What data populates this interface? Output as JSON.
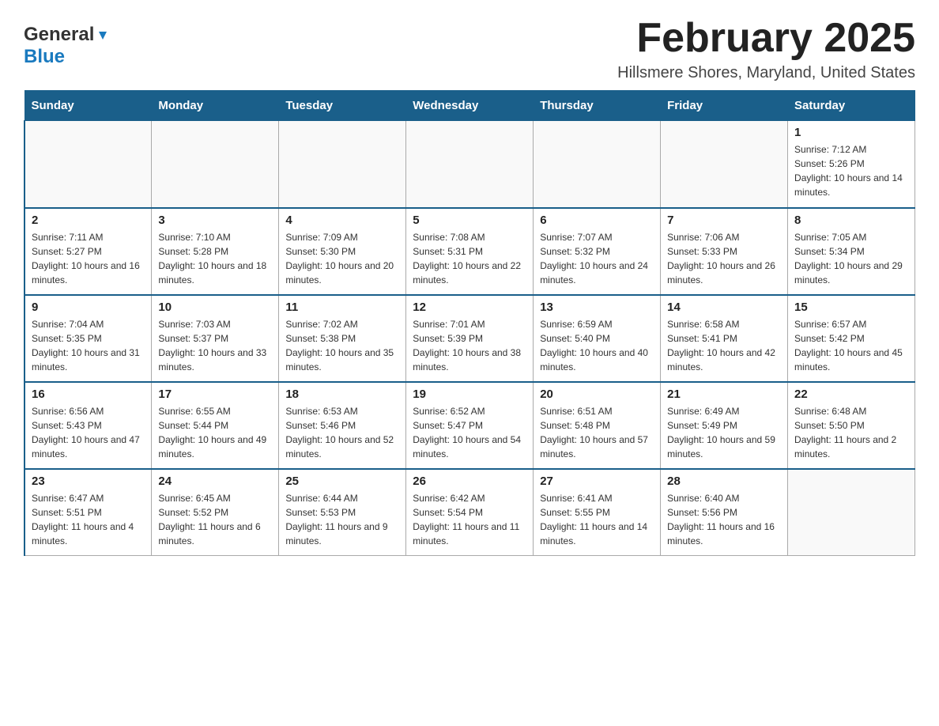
{
  "header": {
    "logo_line1": "General",
    "logo_arrow": "▶",
    "logo_line2": "Blue",
    "month_title": "February 2025",
    "location": "Hillsmere Shores, Maryland, United States"
  },
  "weekdays": [
    "Sunday",
    "Monday",
    "Tuesday",
    "Wednesday",
    "Thursday",
    "Friday",
    "Saturday"
  ],
  "weeks": [
    [
      {
        "day": "",
        "sunrise": "",
        "sunset": "",
        "daylight": ""
      },
      {
        "day": "",
        "sunrise": "",
        "sunset": "",
        "daylight": ""
      },
      {
        "day": "",
        "sunrise": "",
        "sunset": "",
        "daylight": ""
      },
      {
        "day": "",
        "sunrise": "",
        "sunset": "",
        "daylight": ""
      },
      {
        "day": "",
        "sunrise": "",
        "sunset": "",
        "daylight": ""
      },
      {
        "day": "",
        "sunrise": "",
        "sunset": "",
        "daylight": ""
      },
      {
        "day": "1",
        "sunrise": "Sunrise: 7:12 AM",
        "sunset": "Sunset: 5:26 PM",
        "daylight": "Daylight: 10 hours and 14 minutes."
      }
    ],
    [
      {
        "day": "2",
        "sunrise": "Sunrise: 7:11 AM",
        "sunset": "Sunset: 5:27 PM",
        "daylight": "Daylight: 10 hours and 16 minutes."
      },
      {
        "day": "3",
        "sunrise": "Sunrise: 7:10 AM",
        "sunset": "Sunset: 5:28 PM",
        "daylight": "Daylight: 10 hours and 18 minutes."
      },
      {
        "day": "4",
        "sunrise": "Sunrise: 7:09 AM",
        "sunset": "Sunset: 5:30 PM",
        "daylight": "Daylight: 10 hours and 20 minutes."
      },
      {
        "day": "5",
        "sunrise": "Sunrise: 7:08 AM",
        "sunset": "Sunset: 5:31 PM",
        "daylight": "Daylight: 10 hours and 22 minutes."
      },
      {
        "day": "6",
        "sunrise": "Sunrise: 7:07 AM",
        "sunset": "Sunset: 5:32 PM",
        "daylight": "Daylight: 10 hours and 24 minutes."
      },
      {
        "day": "7",
        "sunrise": "Sunrise: 7:06 AM",
        "sunset": "Sunset: 5:33 PM",
        "daylight": "Daylight: 10 hours and 26 minutes."
      },
      {
        "day": "8",
        "sunrise": "Sunrise: 7:05 AM",
        "sunset": "Sunset: 5:34 PM",
        "daylight": "Daylight: 10 hours and 29 minutes."
      }
    ],
    [
      {
        "day": "9",
        "sunrise": "Sunrise: 7:04 AM",
        "sunset": "Sunset: 5:35 PM",
        "daylight": "Daylight: 10 hours and 31 minutes."
      },
      {
        "day": "10",
        "sunrise": "Sunrise: 7:03 AM",
        "sunset": "Sunset: 5:37 PM",
        "daylight": "Daylight: 10 hours and 33 minutes."
      },
      {
        "day": "11",
        "sunrise": "Sunrise: 7:02 AM",
        "sunset": "Sunset: 5:38 PM",
        "daylight": "Daylight: 10 hours and 35 minutes."
      },
      {
        "day": "12",
        "sunrise": "Sunrise: 7:01 AM",
        "sunset": "Sunset: 5:39 PM",
        "daylight": "Daylight: 10 hours and 38 minutes."
      },
      {
        "day": "13",
        "sunrise": "Sunrise: 6:59 AM",
        "sunset": "Sunset: 5:40 PM",
        "daylight": "Daylight: 10 hours and 40 minutes."
      },
      {
        "day": "14",
        "sunrise": "Sunrise: 6:58 AM",
        "sunset": "Sunset: 5:41 PM",
        "daylight": "Daylight: 10 hours and 42 minutes."
      },
      {
        "day": "15",
        "sunrise": "Sunrise: 6:57 AM",
        "sunset": "Sunset: 5:42 PM",
        "daylight": "Daylight: 10 hours and 45 minutes."
      }
    ],
    [
      {
        "day": "16",
        "sunrise": "Sunrise: 6:56 AM",
        "sunset": "Sunset: 5:43 PM",
        "daylight": "Daylight: 10 hours and 47 minutes."
      },
      {
        "day": "17",
        "sunrise": "Sunrise: 6:55 AM",
        "sunset": "Sunset: 5:44 PM",
        "daylight": "Daylight: 10 hours and 49 minutes."
      },
      {
        "day": "18",
        "sunrise": "Sunrise: 6:53 AM",
        "sunset": "Sunset: 5:46 PM",
        "daylight": "Daylight: 10 hours and 52 minutes."
      },
      {
        "day": "19",
        "sunrise": "Sunrise: 6:52 AM",
        "sunset": "Sunset: 5:47 PM",
        "daylight": "Daylight: 10 hours and 54 minutes."
      },
      {
        "day": "20",
        "sunrise": "Sunrise: 6:51 AM",
        "sunset": "Sunset: 5:48 PM",
        "daylight": "Daylight: 10 hours and 57 minutes."
      },
      {
        "day": "21",
        "sunrise": "Sunrise: 6:49 AM",
        "sunset": "Sunset: 5:49 PM",
        "daylight": "Daylight: 10 hours and 59 minutes."
      },
      {
        "day": "22",
        "sunrise": "Sunrise: 6:48 AM",
        "sunset": "Sunset: 5:50 PM",
        "daylight": "Daylight: 11 hours and 2 minutes."
      }
    ],
    [
      {
        "day": "23",
        "sunrise": "Sunrise: 6:47 AM",
        "sunset": "Sunset: 5:51 PM",
        "daylight": "Daylight: 11 hours and 4 minutes."
      },
      {
        "day": "24",
        "sunrise": "Sunrise: 6:45 AM",
        "sunset": "Sunset: 5:52 PM",
        "daylight": "Daylight: 11 hours and 6 minutes."
      },
      {
        "day": "25",
        "sunrise": "Sunrise: 6:44 AM",
        "sunset": "Sunset: 5:53 PM",
        "daylight": "Daylight: 11 hours and 9 minutes."
      },
      {
        "day": "26",
        "sunrise": "Sunrise: 6:42 AM",
        "sunset": "Sunset: 5:54 PM",
        "daylight": "Daylight: 11 hours and 11 minutes."
      },
      {
        "day": "27",
        "sunrise": "Sunrise: 6:41 AM",
        "sunset": "Sunset: 5:55 PM",
        "daylight": "Daylight: 11 hours and 14 minutes."
      },
      {
        "day": "28",
        "sunrise": "Sunrise: 6:40 AM",
        "sunset": "Sunset: 5:56 PM",
        "daylight": "Daylight: 11 hours and 16 minutes."
      },
      {
        "day": "",
        "sunrise": "",
        "sunset": "",
        "daylight": ""
      }
    ]
  ]
}
